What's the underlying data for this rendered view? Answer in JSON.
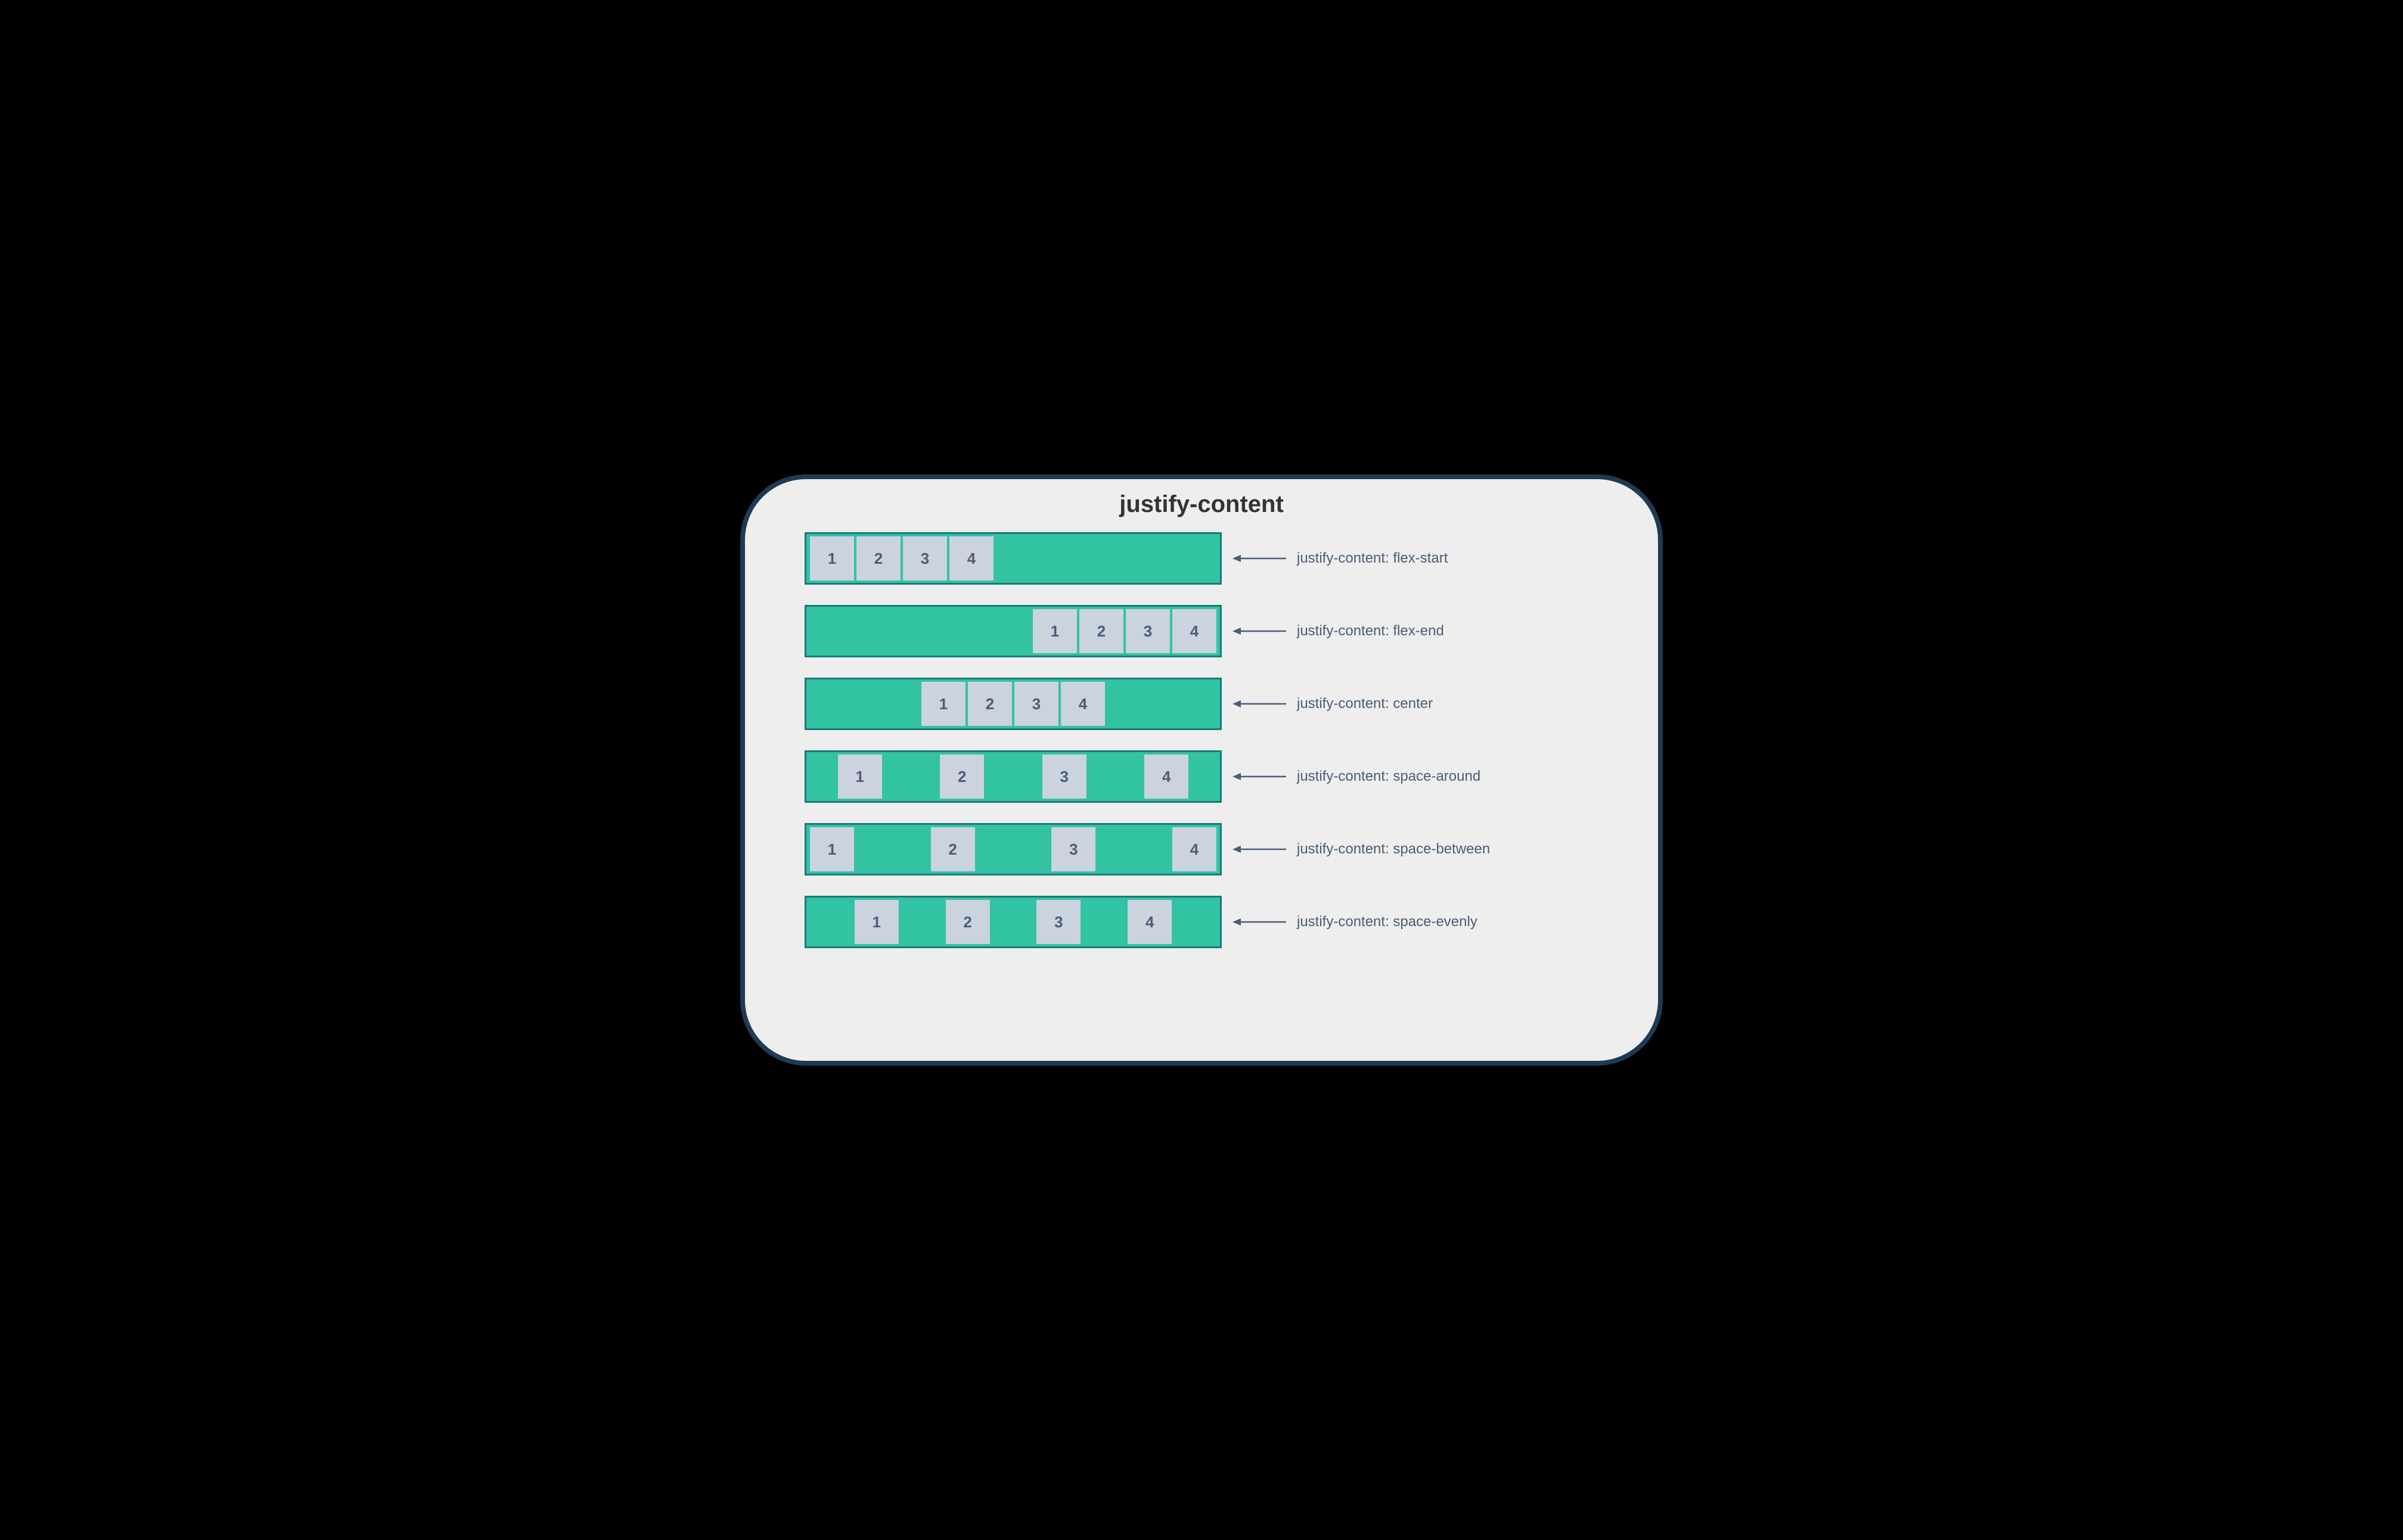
{
  "title": "justify-content",
  "items": [
    "1",
    "2",
    "3",
    "4"
  ],
  "rows": [
    {
      "value": "flex-start",
      "label": "justify-content: flex-start"
    },
    {
      "value": "flex-end",
      "label": "justify-content: flex-end"
    },
    {
      "value": "center",
      "label": "justify-content: center"
    },
    {
      "value": "space-around",
      "label": "justify-content: space-around"
    },
    {
      "value": "space-between",
      "label": "justify-content: space-between"
    },
    {
      "value": "space-evenly",
      "label": "justify-content: space-evenly"
    }
  ],
  "colors": {
    "container_bg": "#32c3a3",
    "container_border": "#1a7a78",
    "item_bg": "#cbd3df",
    "label": "#4a5d77",
    "panel_bg": "#eeeeee",
    "outer_navy": "#1e3a54"
  }
}
